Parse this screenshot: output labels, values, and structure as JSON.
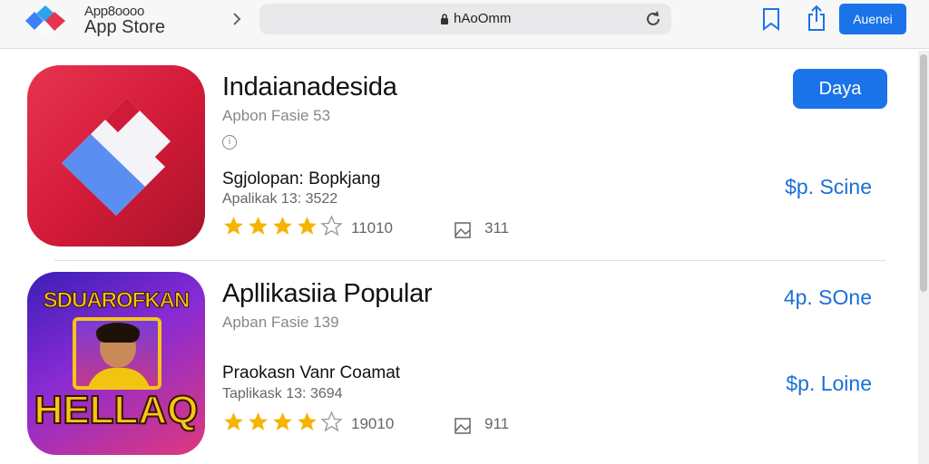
{
  "header": {
    "brand_line1": "App8oooo",
    "brand_line2": "App Store",
    "url": "hAoOmm",
    "action_label": "Auenei"
  },
  "apps": [
    {
      "title": "Indaianadesida",
      "meta": "Apbon Fasie 53",
      "subtitle": "Sgjolopan: Bopkjang",
      "detail": "Apalikak 13: 3522",
      "rating_count": "11010",
      "screenshot_count": "311",
      "stars_filled": 4,
      "button_label": "Daya",
      "price": "$p. Scine"
    },
    {
      "title": "Apllikasiia Popular",
      "meta": "Apban Fasie 139",
      "subtitle": "Praokasn Vanr Coamat",
      "detail": "Taplikask 13: 3694",
      "rating_count": "19010",
      "screenshot_count": "911",
      "stars_filled": 4,
      "price_top": "4p. SOne",
      "price": "$p. Loine",
      "icon_text_top": "SDUAROFKAN",
      "icon_text_bottom": "HELLAQ"
    }
  ],
  "colors": {
    "accent": "#1a73e8",
    "star": "#f5b400",
    "price": "#1a6fd8"
  }
}
